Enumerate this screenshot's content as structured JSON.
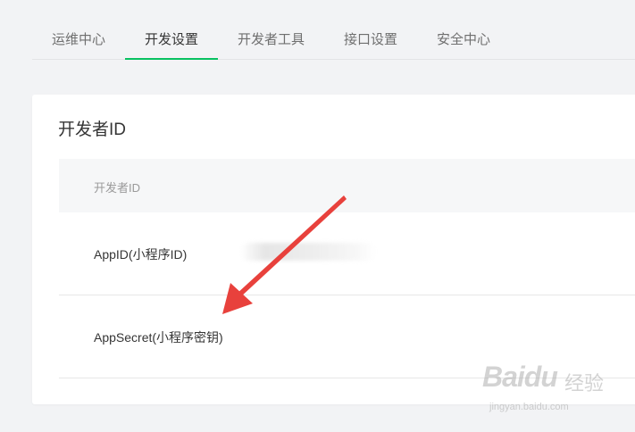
{
  "tabs": [
    {
      "label": "运维中心",
      "active": false
    },
    {
      "label": "开发设置",
      "active": true
    },
    {
      "label": "开发者工具",
      "active": false
    },
    {
      "label": "接口设置",
      "active": false
    },
    {
      "label": "安全中心",
      "active": false
    }
  ],
  "section": {
    "title": "开发者ID",
    "table_header": "开发者ID",
    "rows": [
      {
        "label": "AppID(小程序ID)",
        "value": ""
      },
      {
        "label": "AppSecret(小程序密钥)",
        "value": ""
      }
    ]
  },
  "annotation": {
    "arrow_color": "#e8413c",
    "points_to": "AppSecret(小程序密钥)"
  },
  "watermark": {
    "logo": "Baidu",
    "product": "经验",
    "url": "jingyan.baidu.com"
  },
  "colors": {
    "accent": "#07c160",
    "background": "#f2f3f5",
    "card": "#ffffff"
  }
}
